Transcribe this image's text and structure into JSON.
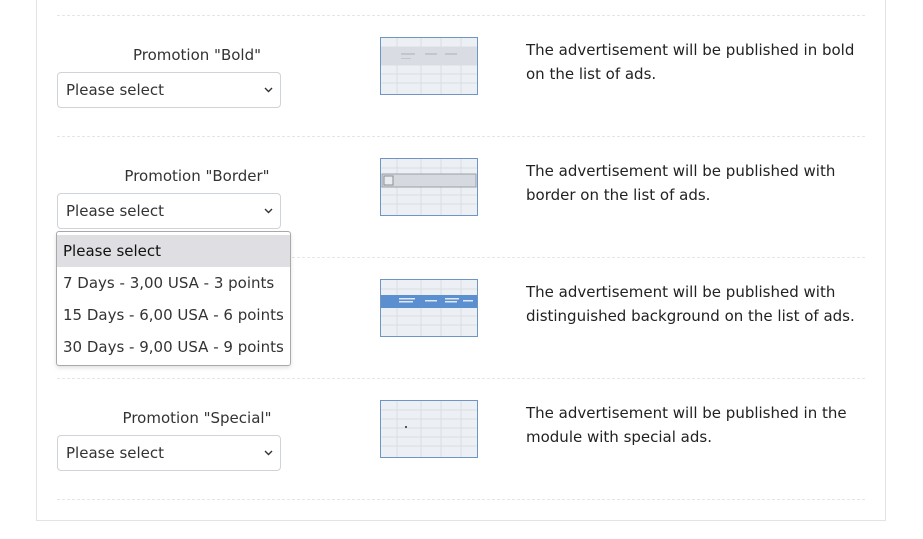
{
  "promotions": [
    {
      "label": "Promotion \"Bold\"",
      "select_value": "Please select",
      "description": "The advertisement will be published in bold on the list of ads."
    },
    {
      "label": "Promotion \"Border\"",
      "select_value": "Please select",
      "description": "The advertisement will be published with border on the list of ads."
    },
    {
      "label": "",
      "select_value": "",
      "description": "The advertisement will be published with distinguished background on the list of ads."
    },
    {
      "label": "Promotion \"Special\"",
      "select_value": "Please select",
      "description": "The advertisement will be published in the module with special ads."
    }
  ],
  "dropdown": {
    "options": [
      "Please select",
      "7 Days - 3,00 USA - 3 points",
      "15 Days - 6,00 USA - 6 points",
      "30 Days - 9,00 USA - 9 points"
    ],
    "selected_index": 0
  },
  "icons": {
    "select_chevron": "chevron-down-icon"
  },
  "colors": {
    "thumb_border": "#6f95c4",
    "highlight_row": "#5b8fd0",
    "dropdown_selected": "#dfdfe3"
  }
}
